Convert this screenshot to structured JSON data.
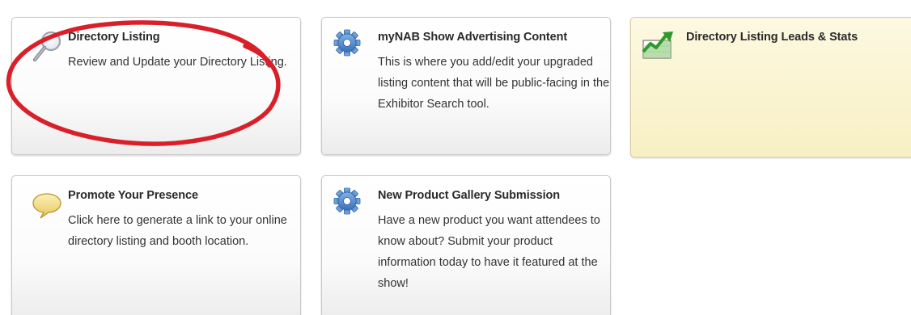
{
  "cards": [
    {
      "title": "Directory Listing",
      "description": "Review and Update your Directory Listing.",
      "icon": "magnifier-icon"
    },
    {
      "title": "myNAB Show Advertising Content",
      "description": "This is where you add/edit your upgraded listing content that will be public-facing in the Exhibitor Search tool.",
      "icon": "gear-icon"
    },
    {
      "title": "Directory Listing Leads & Stats",
      "description": "",
      "icon": "chart-icon"
    },
    {
      "title": "Promote Your Presence",
      "description": "Click here to generate a link to your online directory listing and booth location.",
      "icon": "speech-bubble-icon"
    },
    {
      "title": "New Product Gallery Submission",
      "description": "Have a new product you want attendees to know about? Submit your product information today to have it featured at the show!",
      "icon": "gear-icon"
    }
  ],
  "colors": {
    "annotation_circle": "#d9202a",
    "highlight_card": "#f8efc4",
    "gear": "#4a84c8",
    "chart_up": "#3aa83a",
    "bubble": "#f0d878"
  }
}
